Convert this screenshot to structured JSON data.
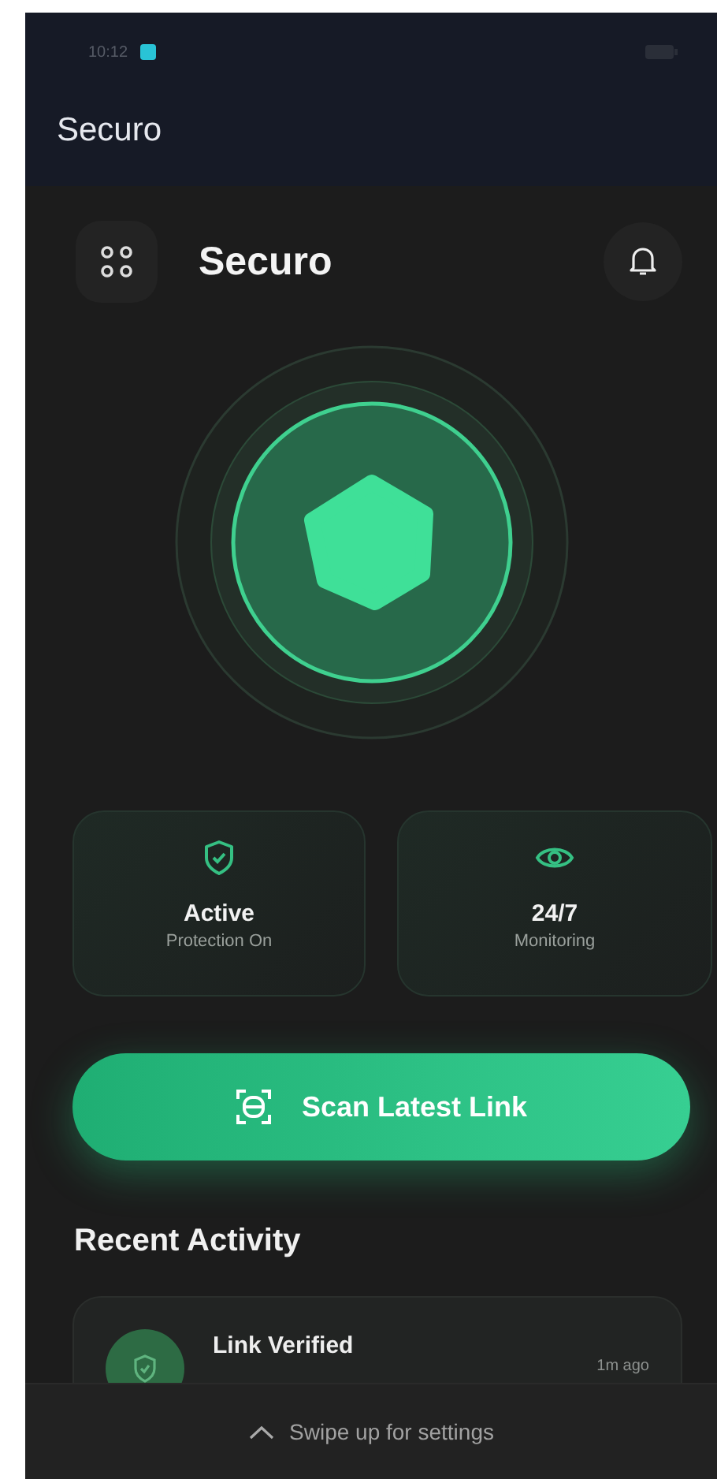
{
  "status_bar": {
    "time": "10:12"
  },
  "app_bar": {
    "title": "Securo"
  },
  "header": {
    "title": "Securo"
  },
  "stats": [
    {
      "kind": "shield",
      "value": "Active",
      "label": "Protection On"
    },
    {
      "kind": "eye",
      "value": "24/7",
      "label": "Monitoring"
    }
  ],
  "scan_button": {
    "label": "Scan Latest Link"
  },
  "recent": {
    "title": "Recent Activity",
    "items": [
      {
        "kind": "verified",
        "title": "Link Verified",
        "time": "1m ago"
      }
    ]
  },
  "bottom_sheet": {
    "hint": "Swipe up for settings"
  }
}
